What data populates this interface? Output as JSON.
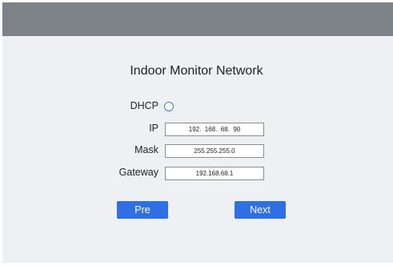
{
  "form": {
    "title": "Indoor Monitor Network",
    "dhcp_label": "DHCP",
    "ip_label": "IP",
    "ip_value": "192.  168.  68.  90",
    "mask_label": "Mask",
    "mask_value": "255.255.255.0",
    "gateway_label": "Gateway",
    "gateway_value": "192.168.68.1"
  },
  "buttons": {
    "pre_label": "Pre",
    "next_label": "Next"
  },
  "colors": {
    "header_bar": "#7d8288",
    "panel_bg": "#eef0f3",
    "button_accent": "#2f6fe6",
    "radio_border": "#3c79d6"
  }
}
